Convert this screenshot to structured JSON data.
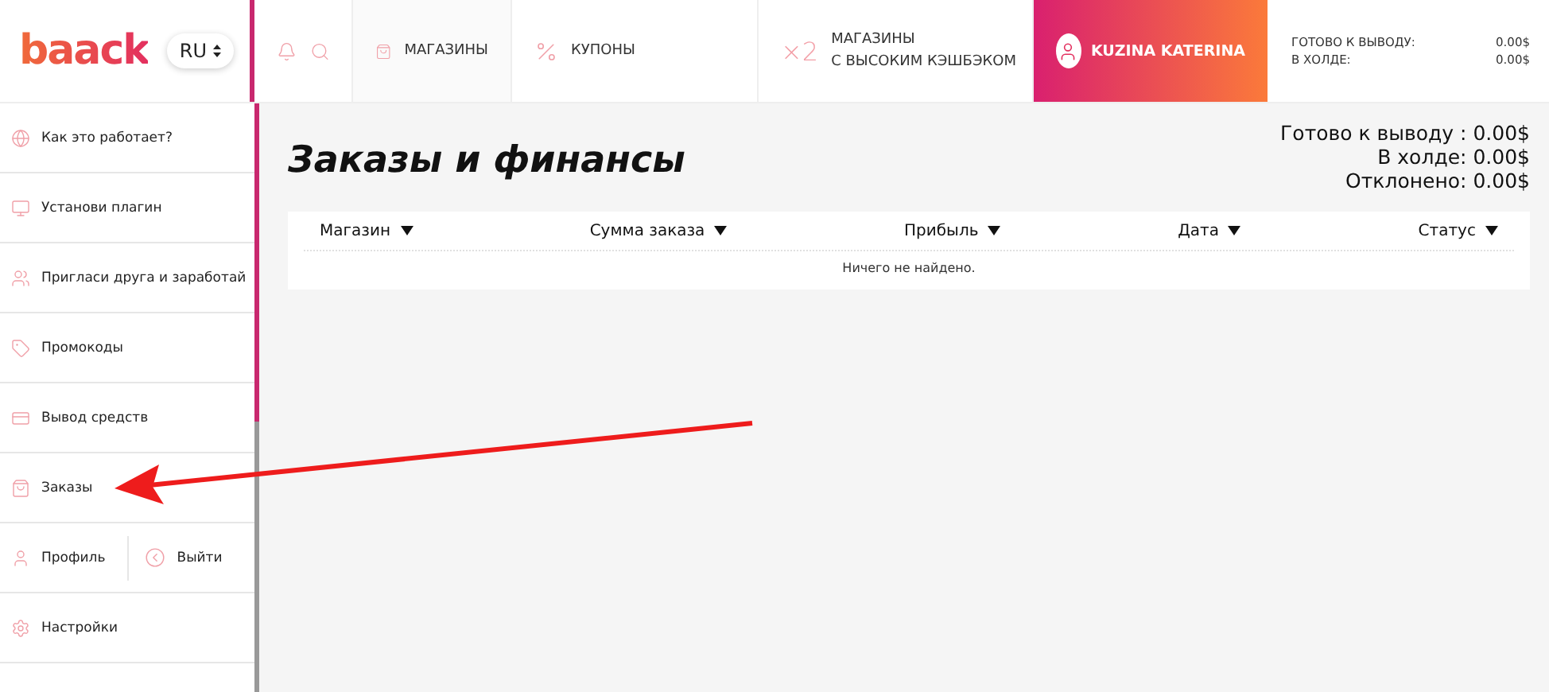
{
  "header": {
    "logo": "baack",
    "language": "RU",
    "nav": [
      {
        "label": "МАГАЗИНЫ"
      },
      {
        "label": "КУПОНЫ"
      }
    ],
    "promo": {
      "badge": "×2",
      "lines": [
        "МАГАЗИНЫ",
        "С ВЫСОКИМ КЭШБЭКОМ"
      ]
    },
    "user": {
      "name": "KUZINA KATERINA"
    },
    "balance": [
      {
        "label": "ГОТОВО К ВЫВОДУ:",
        "value": "0.00$"
      },
      {
        "label": "В ХОЛДЕ:",
        "value": "0.00$"
      }
    ]
  },
  "sidebar": {
    "items": [
      {
        "kind": "single",
        "label": "Как это работает?"
      },
      {
        "kind": "single",
        "label": "Установи плагин"
      },
      {
        "kind": "single",
        "label": "Пригласи друга и заработай"
      },
      {
        "kind": "single",
        "label": "Промокоды"
      },
      {
        "kind": "single",
        "label": "Вывод средств"
      },
      {
        "kind": "single",
        "label": "Заказы"
      },
      {
        "kind": "pair",
        "label": "Профиль",
        "second": "Выйти"
      },
      {
        "kind": "single",
        "label": "Настройки"
      }
    ]
  },
  "main": {
    "title": "Заказы и финансы",
    "totals": [
      "Готово к выводу : 0.00$",
      "В холде: 0.00$",
      "Отклонено: 0.00$"
    ],
    "table": {
      "columns": [
        "Магазин",
        "Сумма заказа",
        "Прибыль",
        "Дата",
        "Статус"
      ],
      "empty": "Ничего не найдено."
    }
  }
}
